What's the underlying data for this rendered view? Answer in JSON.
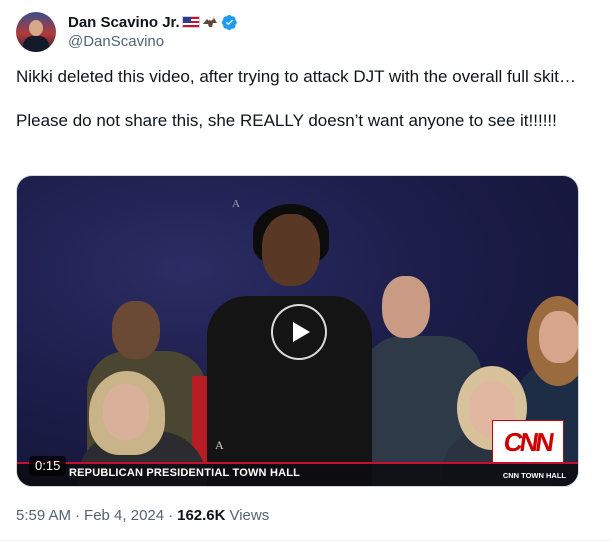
{
  "author": {
    "display_name": "Dan Scavino Jr.",
    "handle": "@DanScavino",
    "name_emojis": [
      "us-flag-icon",
      "eagle-icon"
    ],
    "verified_color": "#1d9bf0"
  },
  "tweet": {
    "paragraphs": [
      "Nikki deleted this video, after trying to attack DJT with the overall full skit…",
      "Please do not share this, she REALLY doesn’t want anyone to see it!!!!!!"
    ]
  },
  "video": {
    "duration": "0:15",
    "chyron": "REPUBLICAN PRESIDENTIAL TOWN HALL",
    "network_logo": "CNN",
    "network_sub": "CNN TOWN HALL",
    "sign_letter": "A",
    "play_icon": "play-icon",
    "accent_color": "#cc0000"
  },
  "meta": {
    "time": "5:59 AM",
    "date": "Feb 4, 2024",
    "separator": "·",
    "views_count": "162.6K",
    "views_label": "Views"
  }
}
